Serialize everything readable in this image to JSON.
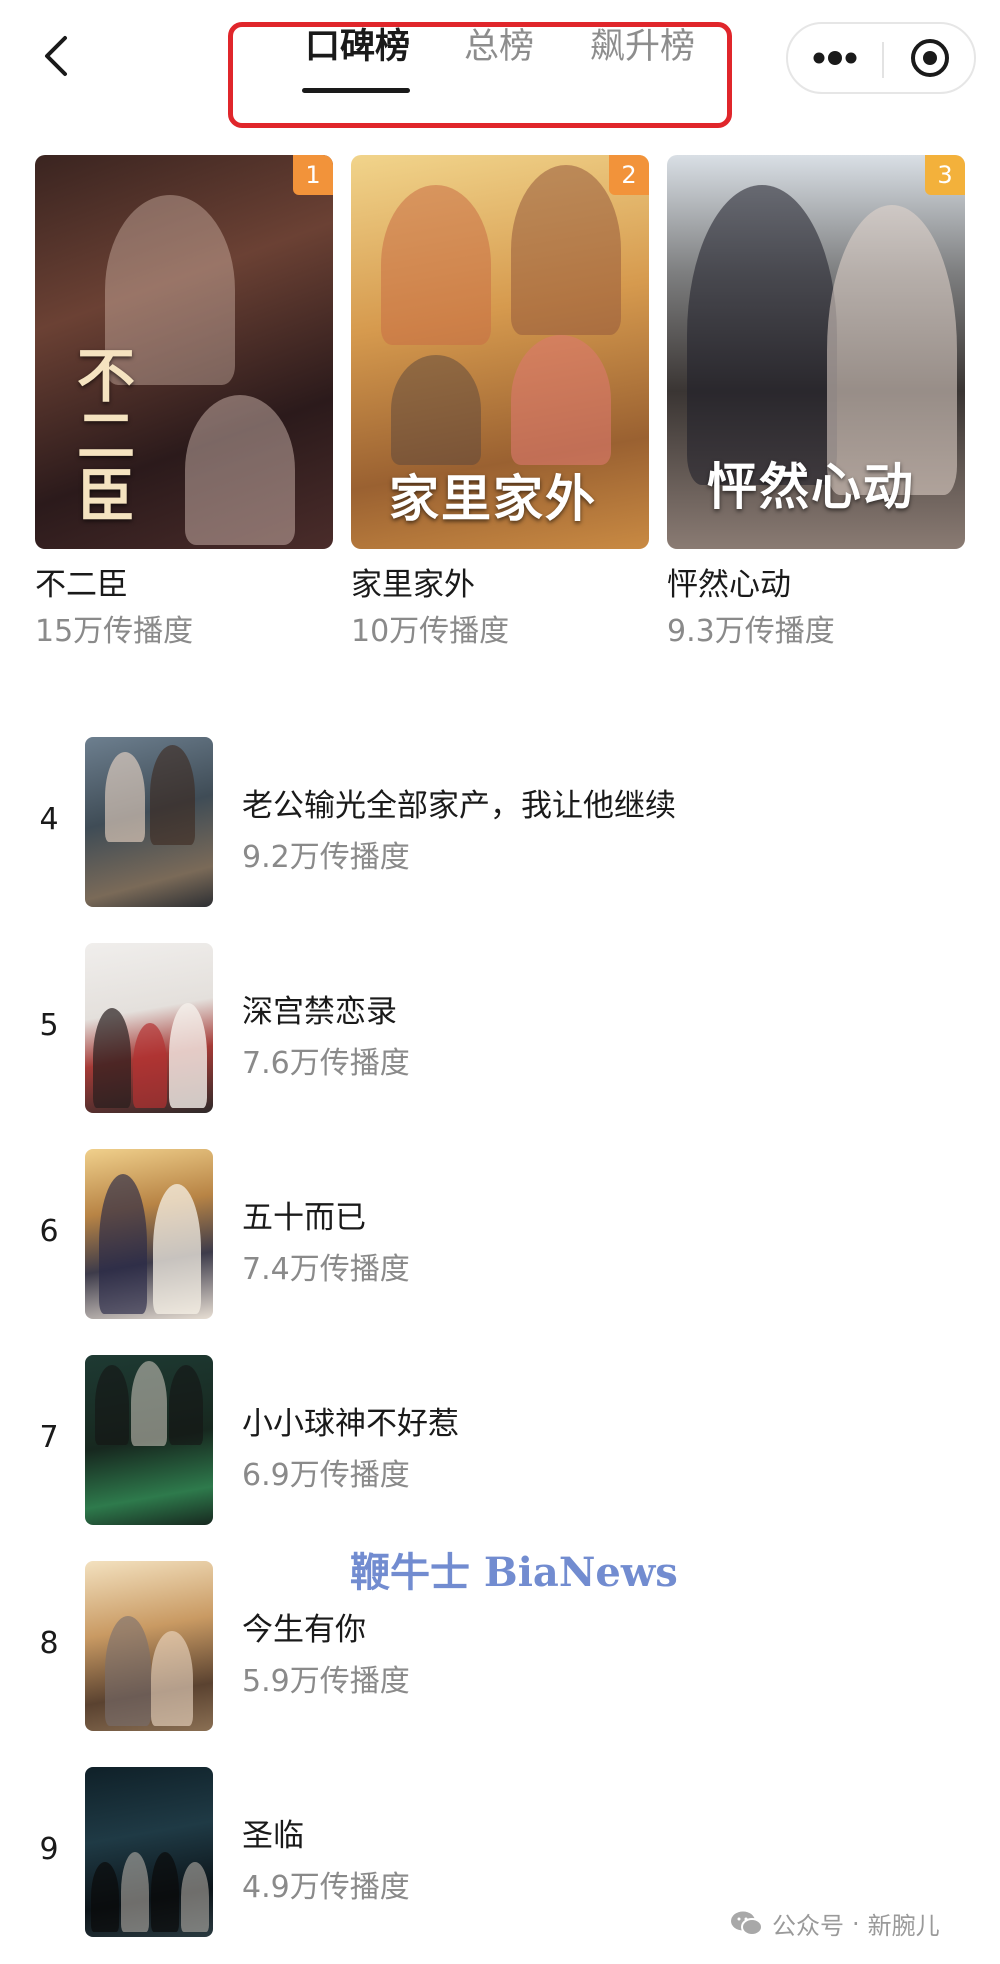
{
  "tabs": [
    {
      "label": "口碑榜",
      "active": true
    },
    {
      "label": "总榜",
      "active": false
    },
    {
      "label": "飙升榜",
      "active": false
    }
  ],
  "top_three": [
    {
      "rank": "1",
      "name": "不二臣",
      "heat": "15万传播度",
      "poster_text": "不二臣"
    },
    {
      "rank": "2",
      "name": "家里家外",
      "heat": "10万传播度",
      "poster_text": "家里家外"
    },
    {
      "rank": "3",
      "name": "怦然心动",
      "heat": "9.3万传播度",
      "poster_text": "怦然心动"
    }
  ],
  "list": [
    {
      "rank": "4",
      "name": "老公输光全部家产，我让他继续",
      "heat": "9.2万传播度"
    },
    {
      "rank": "5",
      "name": "深宫禁恋录",
      "heat": "7.6万传播度"
    },
    {
      "rank": "6",
      "name": "五十而已",
      "heat": "7.4万传播度"
    },
    {
      "rank": "7",
      "name": "小小球神不好惹",
      "heat": "6.9万传播度"
    },
    {
      "rank": "8",
      "name": "今生有你",
      "heat": "5.9万传播度"
    },
    {
      "rank": "9",
      "name": "圣临",
      "heat": "4.9万传播度"
    }
  ],
  "watermark": {
    "bianews": "鞭牛士 BiaNews",
    "wechat_prefix": "公众号",
    "wechat_sep": "·",
    "wechat_name": "新腕儿"
  },
  "colors": {
    "highlight_box": "#e0262b",
    "badge_orange": "#f2933a",
    "badge_gold": "#f3b13b",
    "heat_text": "#8a8a8a"
  },
  "icons": {
    "back": "chevron-left-icon",
    "more": "more-dots-icon",
    "close": "target-circle-icon",
    "wechat": "wechat-icon"
  }
}
